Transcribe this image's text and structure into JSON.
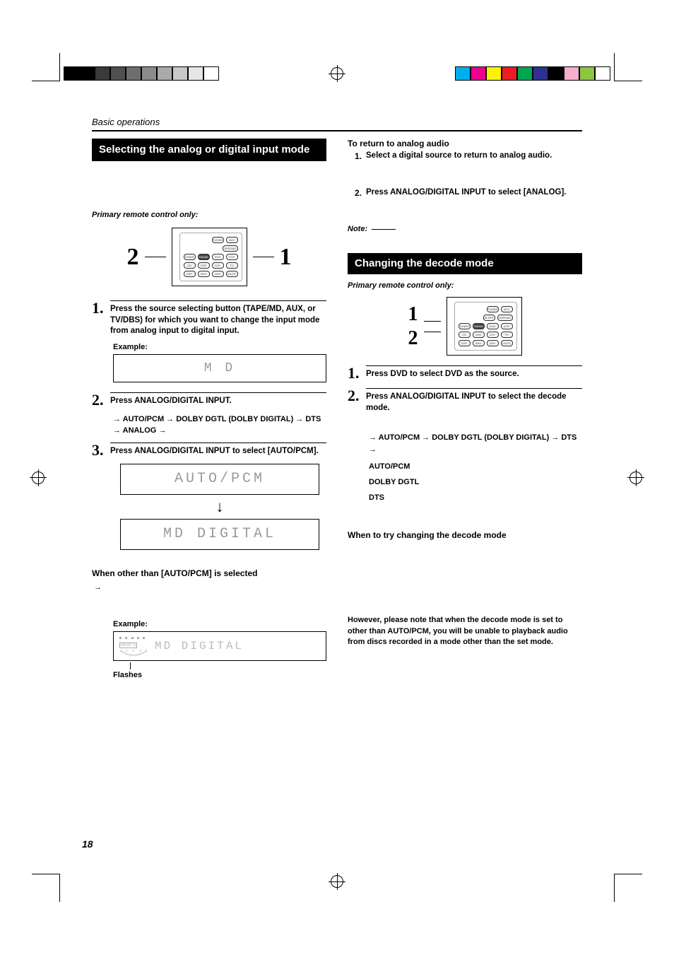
{
  "page": {
    "section_header": "Basic operations",
    "page_number": "18"
  },
  "left": {
    "heading": "Selecting the analog or digital input mode",
    "remote_note": "Primary remote control only:",
    "ptr_num_left": "2",
    "ptr_num_right": "1",
    "step1": {
      "num": "1.",
      "text": "Press the source selecting button (TAPE/MD, AUX, or TV/DBS) for which you want to change the input mode from analog input to digital input."
    },
    "example_label": "Example:",
    "lcd_md": "M D",
    "step2": {
      "num": "2.",
      "text": "Press ANALOG/DIGITAL INPUT."
    },
    "flow_line": "→ AUTO/PCM → DOLBY DGTL (DOLBY DIGITAL) → DTS → ANALOG →",
    "step3": {
      "num": "3.",
      "text": "Press ANALOG/DIGITAL INPUT to select [AUTO/PCM]."
    },
    "lcd_auto": "AUTO/PCM",
    "lcd_md_digital": "MD  DIGITAL",
    "other_heading": "When other than [AUTO/PCM] is selected",
    "other_arrow": "→",
    "example2_label": "Example:",
    "lcd_example2": "MD   DIGITAL",
    "flashes_label": "Flashes"
  },
  "right": {
    "return_head": "To return to analog audio",
    "r_step1": {
      "n": "1.",
      "t": "Select a digital source to return to analog audio."
    },
    "r_step2": {
      "n": "2.",
      "t": "Press ANALOG/DIGITAL INPUT to select [ANALOG]."
    },
    "note_label": "Note:",
    "heading2": "Changing the decode mode",
    "remote_note2": "Primary remote control only:",
    "ptr2_num_top": "1",
    "ptr2_num_bot": "2",
    "step1b": {
      "num": "1.",
      "text": "Press DVD to select DVD as the source."
    },
    "step2b": {
      "num": "2.",
      "text": "Press ANALOG/DIGITAL INPUT to select the decode mode."
    },
    "flow_line2": "→ AUTO/PCM → DOLBY DGTL (DOLBY DIGITAL) → DTS →",
    "term_auto": "AUTO/PCM",
    "term_dolby": "DOLBY DGTL",
    "term_dts": "DTS",
    "when_heading": "When to try changing the decode mode",
    "however_note": "However, please note that when the decode mode is set to other than AUTO/PCM, you will be unable to playback audio from discs recorded in a mode other than the set mode."
  },
  "colorbars_left": [
    "#000",
    "#000",
    "#3a3a3a",
    "#505050",
    "#6e6e6e",
    "#8c8c8c",
    "#aaa",
    "#c8c8c8",
    "#e6e6e6",
    "#fff"
  ],
  "colorbars_right": [
    "#00aeef",
    "#ec008c",
    "#fff200",
    "#ed1c24",
    "#00a651",
    "#2e3192",
    "#000",
    "#f7adc9",
    "#8dc63f",
    "#fff"
  ]
}
